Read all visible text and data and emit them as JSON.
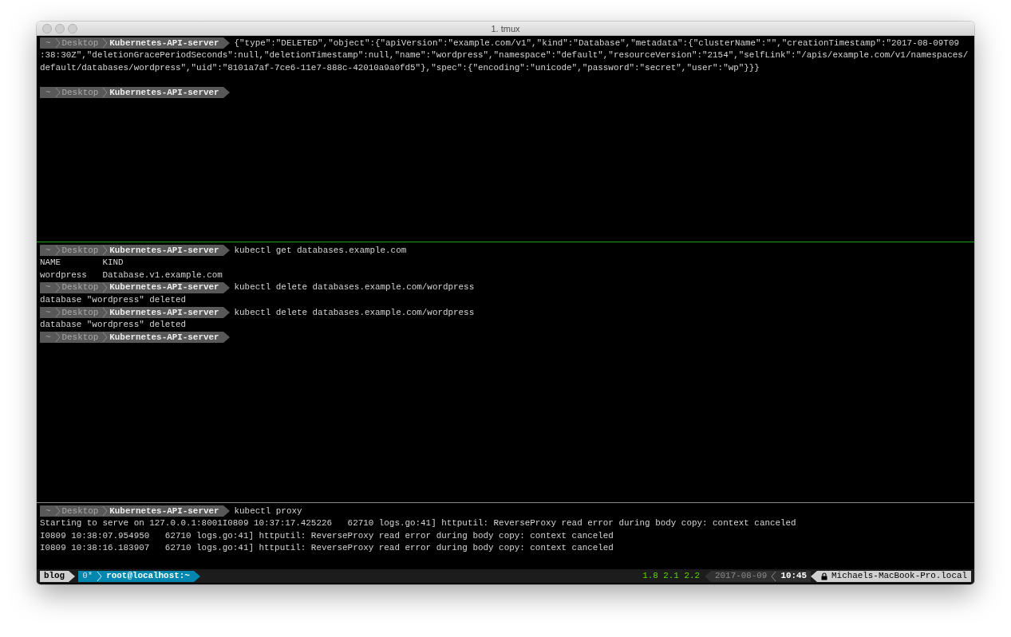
{
  "window": {
    "title": "1. tmux"
  },
  "panes": [
    {
      "lines": [
        {
          "kind": "prompt",
          "segments": [
            "~",
            "Desktop",
            "Kubernetes-API-server"
          ],
          "command": "{\"type\":\"DELETED\",\"object\":{\"apiVersion\":\"example.com/v1\",\"kind\":\"Database\",\"metadata\":{\"clusterName\":\"\",\"creationTimestamp\":\"2017-08-09T09"
        },
        {
          "kind": "output",
          "text": ":38:30Z\",\"deletionGracePeriodSeconds\":null,\"deletionTimestamp\":null,\"name\":\"wordpress\",\"namespace\":\"default\",\"resourceVersion\":\"2154\",\"selfLink\":\"/apis/example.com/v1/namespaces/"
        },
        {
          "kind": "output",
          "text": "default/databases/wordpress\",\"uid\":\"8101a7af-7ce6-11e7-888c-42010a9a0fd5\"},\"spec\":{\"encoding\":\"unicode\",\"password\":\"secret\",\"user\":\"wp\"}}}"
        },
        {
          "kind": "blank"
        },
        {
          "kind": "prompt",
          "segments": [
            "~",
            "Desktop",
            "Kubernetes-API-server"
          ]
        }
      ]
    },
    {
      "lines": [
        {
          "kind": "prompt",
          "segments": [
            "~",
            "Desktop",
            "Kubernetes-API-server"
          ],
          "command": "kubectl get databases.example.com"
        },
        {
          "kind": "output",
          "text": "NAME        KIND"
        },
        {
          "kind": "output",
          "text": "wordpress   Database.v1.example.com"
        },
        {
          "kind": "prompt",
          "segments": [
            "~",
            "Desktop",
            "Kubernetes-API-server"
          ],
          "command": "kubectl delete databases.example.com/wordpress"
        },
        {
          "kind": "output",
          "text": "database \"wordpress\" deleted"
        },
        {
          "kind": "prompt",
          "segments": [
            "~",
            "Desktop",
            "Kubernetes-API-server"
          ],
          "command": "kubectl delete databases.example.com/wordpress"
        },
        {
          "kind": "output",
          "text": "database \"wordpress\" deleted"
        },
        {
          "kind": "prompt",
          "segments": [
            "~",
            "Desktop",
            "Kubernetes-API-server"
          ]
        }
      ]
    },
    {
      "lines": [
        {
          "kind": "prompt",
          "segments": [
            "~",
            "Desktop",
            "Kubernetes-API-server"
          ],
          "command": "kubectl proxy"
        },
        {
          "kind": "output",
          "text": "Starting to serve on 127.0.0.1:8001I0809 10:37:17.425226   62710 logs.go:41] httputil: ReverseProxy read error during body copy: context canceled"
        },
        {
          "kind": "output",
          "text": "I0809 10:38:07.954950   62710 logs.go:41] httputil: ReverseProxy read error during body copy: context canceled"
        },
        {
          "kind": "output",
          "text": "I0809 10:38:16.183907   62710 logs.go:41] httputil: ReverseProxy read error during body copy: context canceled"
        }
      ]
    }
  ],
  "pane_dividers": [
    {
      "highlighted": true
    },
    {
      "highlighted": false
    }
  ],
  "status_bar": {
    "session": "blog",
    "window_index": "0*",
    "window_name": "root@localhost:~",
    "load": "1.8 2.1 2.2",
    "date": "2017-08-09",
    "time": "10:45",
    "host": "Michaels-MacBook-Pro.local"
  }
}
